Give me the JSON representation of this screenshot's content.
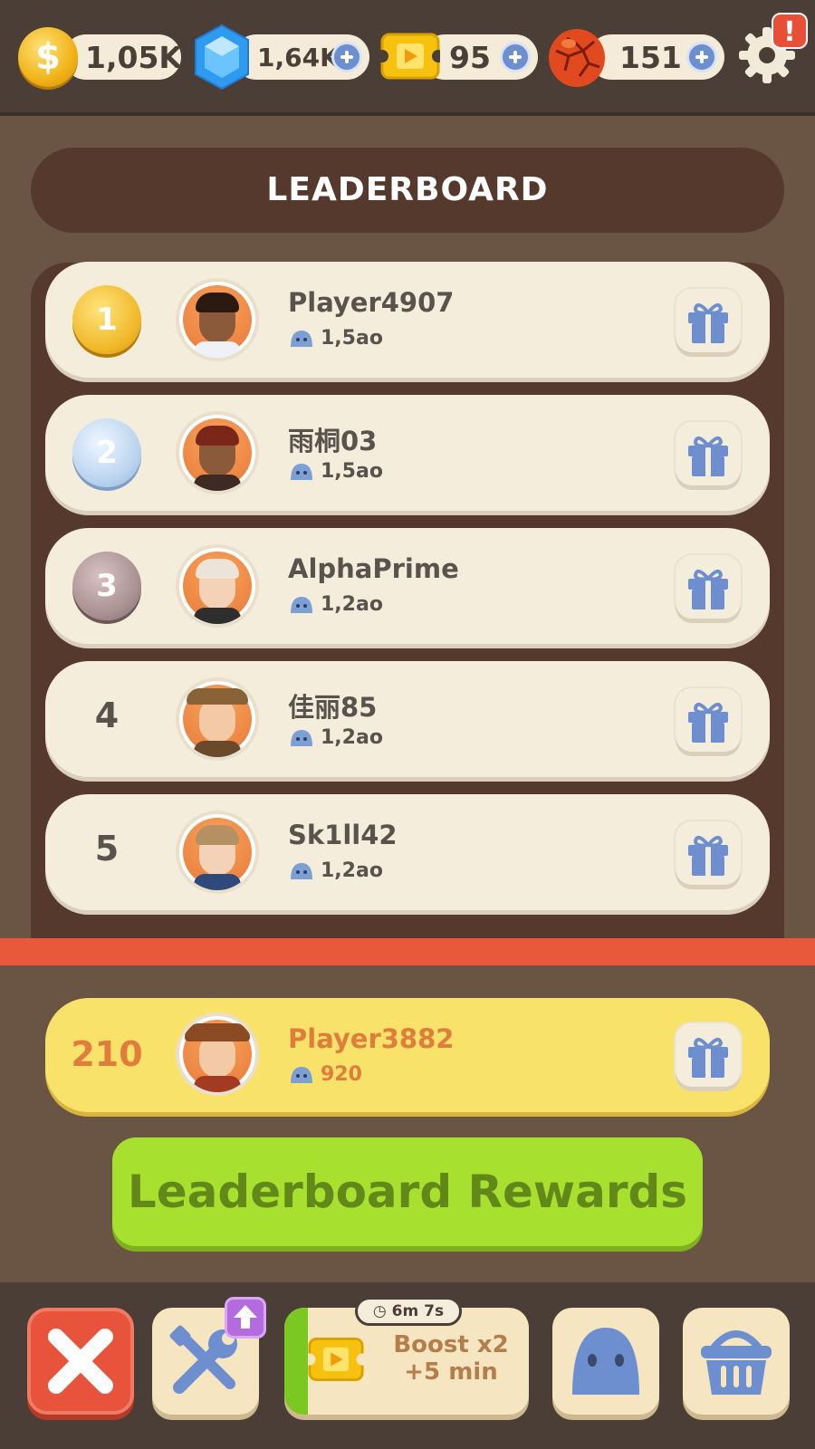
{
  "resources": {
    "coins": "1,05K",
    "gems": "1,64K",
    "tickets": "95",
    "lava": "151"
  },
  "icons": {
    "coin": "coin-icon",
    "gem": "gem-icon",
    "ticket": "ticket-icon",
    "lava": "lava-rock-icon",
    "settings": "gear-icon",
    "alert": "!"
  },
  "title": "LEADERBOARD",
  "rows": [
    {
      "rank": "1",
      "name": "Player4907",
      "score": "1,5ao"
    },
    {
      "rank": "2",
      "name": "雨桐03",
      "score": "1,5ao"
    },
    {
      "rank": "3",
      "name": "AlphaPrime",
      "score": "1,2ao"
    },
    {
      "rank": "4",
      "name": "佳丽85",
      "score": "1,2ao"
    },
    {
      "rank": "5",
      "name": "Sk1ll42",
      "score": "1,2ao"
    }
  ],
  "me": {
    "rank": "210",
    "name": "Player3882",
    "score": "920"
  },
  "rewards_button": "Leaderboard Rewards",
  "bottom": {
    "timer": "6m 7s",
    "boost_line1": "Boost x2",
    "boost_line2": "+5 min"
  },
  "colors": {
    "accent_green": "#a8e030",
    "highlight_yellow": "#f9e26a",
    "close_red": "#e8533b"
  }
}
